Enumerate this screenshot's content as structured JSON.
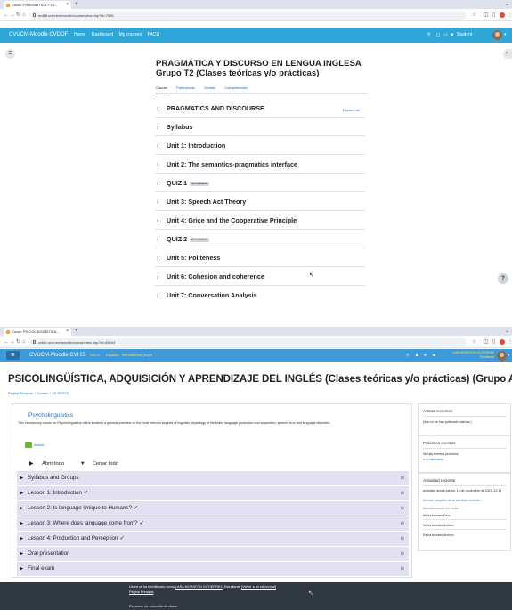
{
  "screen1": {
    "tab_title": "Curso: PRAGMÁTICA Y DI...",
    "url": "mdfdf.ucm.es/moodle/course/view.php?id=7065",
    "nav": {
      "brand": "CVUCM-Moodle CVDOF",
      "links": [
        "Home",
        "Dashboard",
        "My courses",
        "PACU"
      ],
      "user": "Student"
    },
    "course_title": "PRAGMÁTICA Y DISCURSO EN LENGUA INGLESA Grupo T2 (Clases teóricas y/o prácticas)",
    "tabs": [
      "Course",
      "Participants",
      "Grades",
      "Competencies"
    ],
    "expand_all": "Expand all",
    "sections": [
      {
        "title": "PRAGMATICS AND DISCOURSE",
        "badge": ""
      },
      {
        "title": "Syllabus",
        "badge": ""
      },
      {
        "title": "Unit 1: Introduction",
        "badge": ""
      },
      {
        "title": "Unit 2: The semantics-pragmatics interface",
        "badge": ""
      },
      {
        "title": "QUIZ 1",
        "badge": "Not available"
      },
      {
        "title": "Unit 3: Speech Act Theory",
        "badge": ""
      },
      {
        "title": "Unit 4: Grice and the Cooperative Principle",
        "badge": ""
      },
      {
        "title": "QUIZ 2",
        "badge": "Not available"
      },
      {
        "title": "Unit 5: Politeness",
        "badge": ""
      },
      {
        "title": "Unit 6: Cohesion and coherence",
        "badge": ""
      },
      {
        "title": "Unit 7: Conversation Analysis",
        "badge": ""
      }
    ],
    "help": "?"
  },
  "screen2": {
    "tab_title": "Curso: PSICOLINGÜÍSTICA...",
    "url": "ccfdc.ucm.es/moodle/course/view.php?id=49044",
    "nav": {
      "brand": "CVUCM-Moodle CVHIS",
      "links": [
        "PACU",
        "Español - Internacional (es) ▾"
      ],
      "user_name": "LARA MORATON GUTIERREZ",
      "user_role": "Estudiante"
    },
    "course_title": "PSICOLINGÜÍSTICA, ADQUISICIÓN Y APRENDIZAJE DEL INGLÉS (Clases teóricas y/o prácticas) (Grupo A)",
    "breadcrumb": [
      "Página Principal",
      "Cursos",
      "22-359272"
    ],
    "section_title": "Psycholinguistics",
    "section_desc": "This introductory course on Psycholinguistics offers students a general overview on the most relevant aspects of linguistic physiology of the brain, language production and acquisition, speech error and language disorders.",
    "avisos": "Avisos",
    "expand": "Abrir todo",
    "collapse": "Cerrar todo",
    "rows": [
      {
        "title": "Syllabus and Groups",
        "check": ""
      },
      {
        "title": "Lesson 1: Introduction",
        "check": "✓"
      },
      {
        "title": "Lesson 2: Is language Unique to Humans?",
        "check": "✓"
      },
      {
        "title": "Lesson 3: Where does language come from?",
        "check": "✓"
      },
      {
        "title": "Lesson 4: Production and Perception",
        "check": "✓"
      },
      {
        "title": "Oral presentation",
        "check": ""
      },
      {
        "title": "Final exam",
        "check": ""
      }
    ],
    "sidebar": {
      "news_title": "Avisos recientes",
      "news_text": "(Aún no se han publicado noticias.)",
      "events_title": "Próximos eventos",
      "events_text": "No hay eventos próximos",
      "events_link": "Ir al calendario...",
      "activity_title": "Actividad reciente",
      "activity_since": "Actividad desde jueves, 16 de noviembre de 2023, 22:18",
      "activity_report": "Informe completo de la actividad reciente...",
      "activity_updates": "Actualizaciones del curso:",
      "activity_items": [
        "Se ha borrado Foro",
        "Se ha borrado Archivo",
        "Se ha borrado Archivo"
      ]
    },
    "footer": {
      "logged_as_prefix": "Usted se ha identificado como ",
      "logged_as_name": "LARA MORATON GUTIERREZ",
      "logged_as_role": ": Estudiante ",
      "return_role": "(Volver a mi rol normal)",
      "home": "Página Principal",
      "retention": "Resumen de retención de datos"
    }
  }
}
